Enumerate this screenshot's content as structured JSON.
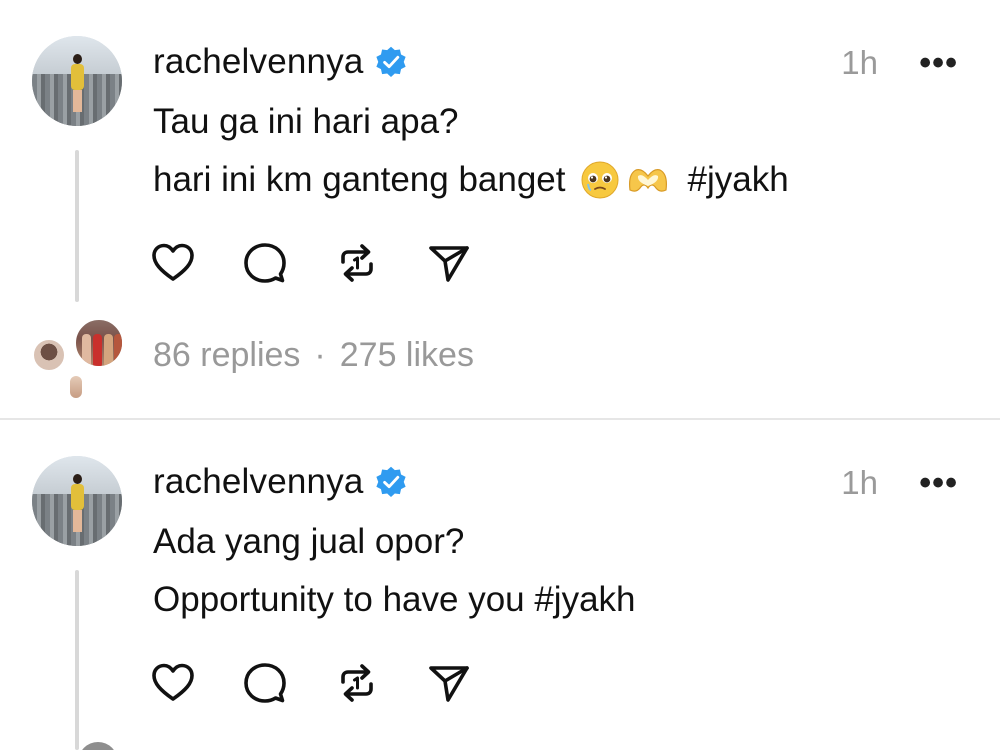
{
  "posts": [
    {
      "username": "rachelvennya",
      "time": "1h",
      "more": "•••",
      "lines": [
        "Tau ga ini hari apa?",
        "hari ini km ganteng banget",
        "#jyakh"
      ],
      "emojis": [
        "pleading-face",
        "heart-hands"
      ],
      "replies": "86 replies",
      "separator": "·",
      "likes": "275 likes"
    },
    {
      "username": "rachelvennya",
      "time": "1h",
      "more": "•••",
      "lines": [
        "Ada yang jual opor?",
        "Opportunity to have you #jyakh"
      ]
    }
  ],
  "colors": {
    "verified": "#2f9bf0",
    "muted_text": "#999999",
    "thread_line": "#d8d8d8"
  },
  "icons": [
    "heart-icon",
    "comment-icon",
    "repost-icon",
    "share-icon",
    "verified-badge-icon",
    "more-icon"
  ]
}
